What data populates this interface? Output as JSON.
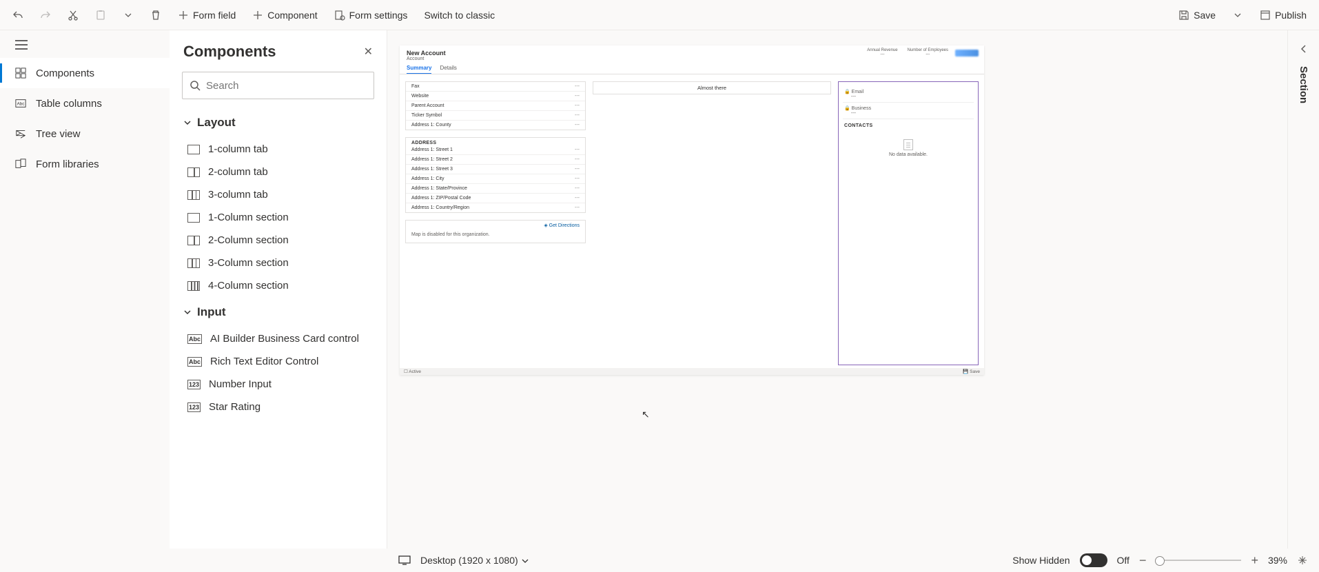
{
  "toolbar": {
    "form_field": "Form field",
    "component": "Component",
    "form_settings": "Form settings",
    "switch_classic": "Switch to classic",
    "save": "Save",
    "publish": "Publish"
  },
  "leftnav": {
    "items": [
      {
        "label": "Components"
      },
      {
        "label": "Table columns"
      },
      {
        "label": "Tree view"
      },
      {
        "label": "Form libraries"
      }
    ]
  },
  "panel": {
    "title": "Components",
    "search_placeholder": "Search",
    "groups": {
      "layout": {
        "title": "Layout",
        "items": [
          "1-column tab",
          "2-column tab",
          "3-column tab",
          "1-Column section",
          "2-Column section",
          "3-Column section",
          "4-Column section"
        ]
      },
      "input": {
        "title": "Input",
        "items": [
          "AI Builder Business Card control",
          "Rich Text Editor Control",
          "Number Input",
          "Star Rating"
        ]
      }
    }
  },
  "form": {
    "title": "New Account",
    "subtitle": "Account",
    "tabs": [
      "Summary",
      "Details"
    ],
    "header_metrics": [
      "Annual Revenue",
      "Number of Employees"
    ],
    "colA_top": [
      {
        "label": "Fax",
        "value": "---"
      },
      {
        "label": "Website",
        "value": "---"
      },
      {
        "label": "Parent Account",
        "value": "---"
      },
      {
        "label": "Ticker Symbol",
        "value": "---"
      },
      {
        "label": "Address 1: County",
        "value": "---"
      }
    ],
    "address_title": "ADDRESS",
    "address_rows": [
      {
        "label": "Address 1: Street 1",
        "value": "---"
      },
      {
        "label": "Address 1: Street 2",
        "value": "---"
      },
      {
        "label": "Address 1: Street 3",
        "value": "---"
      },
      {
        "label": "Address 1: City",
        "value": "---"
      },
      {
        "label": "Address 1: State/Province",
        "value": "---"
      },
      {
        "label": "Address 1: ZIP/Postal Code",
        "value": "---"
      },
      {
        "label": "Address 1: Country/Region",
        "value": "---"
      }
    ],
    "get_directions": "Get Directions",
    "map_disabled": "Map is disabled for this organization.",
    "almost_there": "Almost there",
    "side_rows": [
      "Email",
      "Business"
    ],
    "side_dash": "---",
    "contacts_title": "CONTACTS",
    "no_data": "No data available.",
    "footer_status": "Active",
    "footer_save": "Save"
  },
  "rightrail": {
    "label": "Section"
  },
  "status": {
    "viewport": "Desktop (1920 x 1080)",
    "show_hidden": "Show Hidden",
    "toggle_label": "Off",
    "zoom": "39%"
  }
}
